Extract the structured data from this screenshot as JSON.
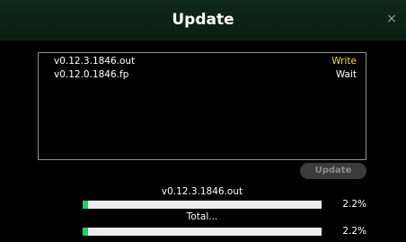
{
  "dialog": {
    "title": "Update",
    "close_glyph": "×"
  },
  "file_list": [
    {
      "name": "v0.12.3.1846.out",
      "status": "Write",
      "status_color": "#f2e20a"
    },
    {
      "name": "v0.12.0.1846.fp",
      "status": "Wait",
      "status_color": "#ffffff"
    }
  ],
  "update_button": {
    "label": "Update",
    "enabled": false
  },
  "file_progress": {
    "label": "v0.12.3.1846.out",
    "percent_text": "2.2%",
    "fraction": 0.022
  },
  "total_progress": {
    "label": "Total...",
    "percent_text": "2.2%",
    "fraction": 0.022
  },
  "colors": {
    "progress_fill": "#1fcf63",
    "progress_track": "#ececec"
  }
}
